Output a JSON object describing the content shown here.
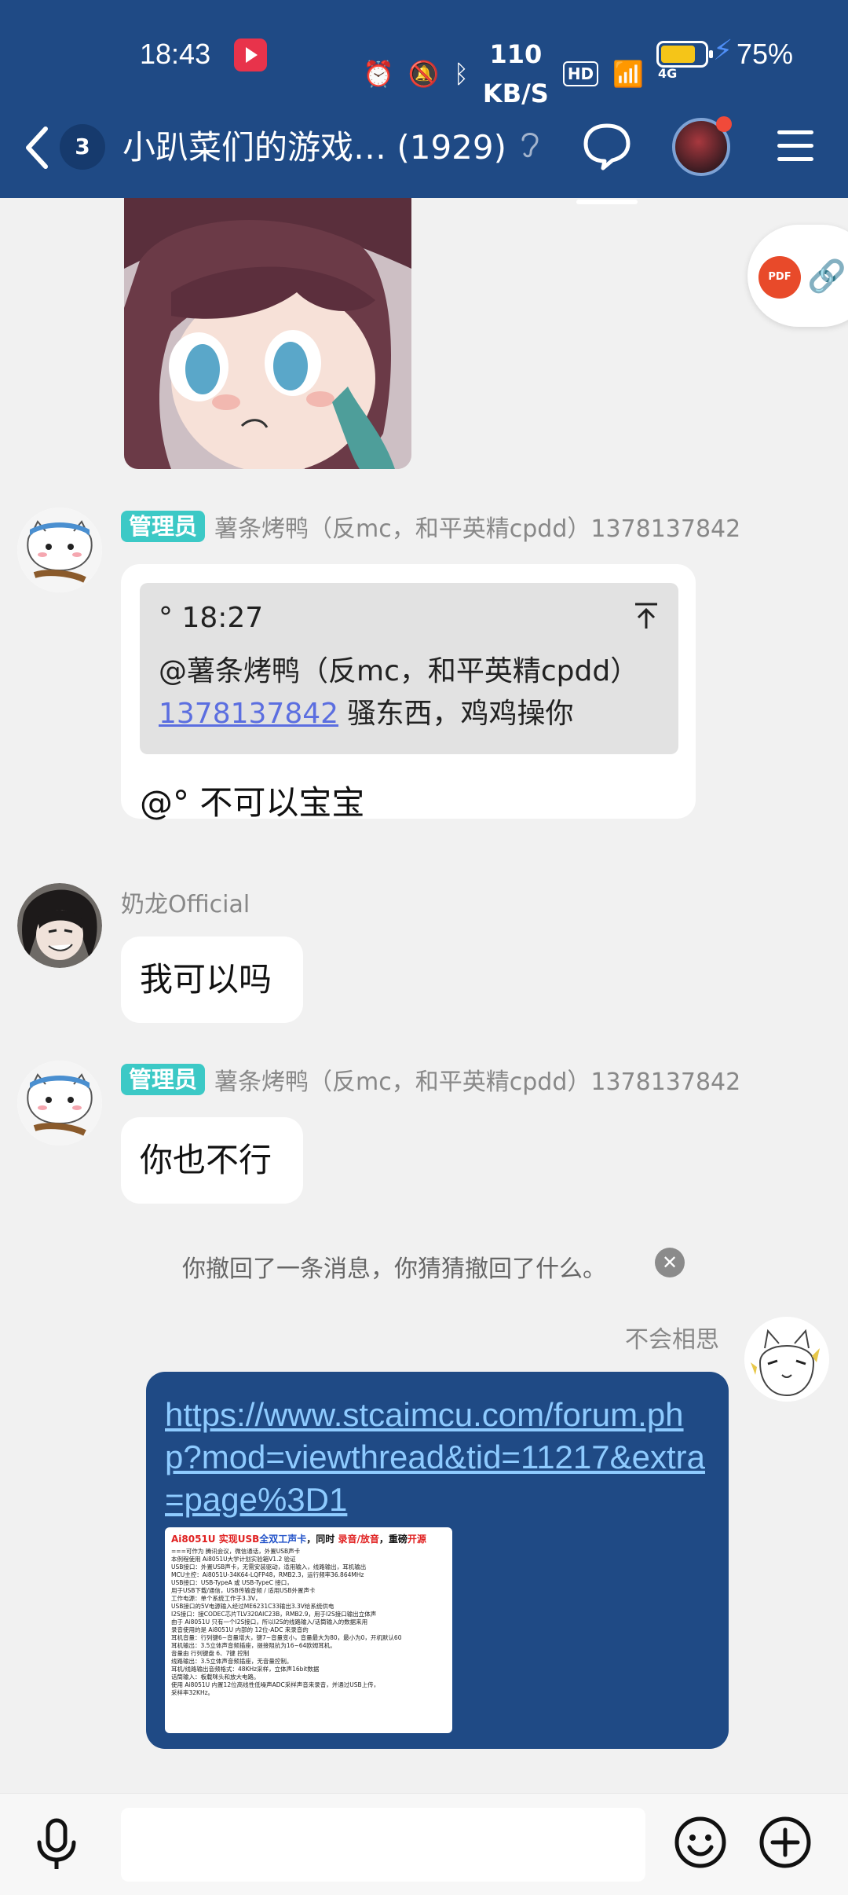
{
  "status_bar": {
    "time": "18:43",
    "network_speed_value": "110",
    "network_speed_unit": "KB/S",
    "hd_label": "HD",
    "signal_label": "4G",
    "battery_percent": "75%"
  },
  "header": {
    "unread_count": "3",
    "group_title": "小趴菜们的游戏…  (1929)"
  },
  "messages": [
    {
      "sender": "薯条烤鸭（反mc，和平英精cpdd）1378137842",
      "role_tag": "管理员",
      "quote": {
        "time": "° 18:27",
        "text_prefix": "@薯条烤鸭（反mc，和平英精cpdd）",
        "link": "1378137842",
        "text_suffix": " 骚东西，鸡鸡操你"
      },
      "text": "@° 不可以宝宝"
    },
    {
      "sender": "奶龙Official",
      "text": "我可以吗"
    },
    {
      "sender": "薯条烤鸭（反mc，和平英精cpdd）1378137842",
      "role_tag": "管理员",
      "text": "你也不行"
    }
  ],
  "system_message": "你撤回了一条消息，你猜猜撤回了什么。",
  "my_message": {
    "sender": "不会相思",
    "url": "https://www.stcaimcu.com/forum.php?mod=viewthread&tid=11217&extra=page%3D1",
    "preview": {
      "title_a": "Ai8051U 实现USB",
      "title_b": "全双工声卡",
      "title_c": "，同时 ",
      "title_d": "录音/放音",
      "title_e": "，重磅",
      "title_f": "开源",
      "lines": [
        "===可作为 腾讯会议，微信通话，外置USB声卡",
        "本例程使用 Ai8051U大学计划实验箱V1.2 验证",
        "USB接口：外置USB声卡，无需安装驱动，适用输入，线路输出，耳机输出",
        "MCU主控：Ai8051U-34K64-LQFP48，RMB2.3，运行频率36.864MHz",
        "USB接口：USB-TypeA 或 USB-TypeC 接口，",
        "          用于USB下载/通信，USB传输音频 / 适用USB外置声卡",
        "工作电源：单个系统工作于3.3V，",
        "          USB接口的5V电源输入经过ME6231C33输出3.3V给系统供电",
        "I2S接口：接CODEC芯片TLV320AIC23B，RMB2.9，用于I2S接口输出立体声",
        "          由于 Ai8051U 只有一个I2S接口，所以I2S的线路输入/话筒输入的数据来用",
        "          录音使用的是 Ai8051U 内部的 12位-ADC 来录音的",
        "耳机音量：行列键6~音量增大，键7~音量变小，音量最大为80，最小为0，开机默认60",
        "耳机输出：3.5立体声音频插座，提接阻抗为16~64欧姆耳机。",
        "          音量由 行列键盘 6、7键 控制",
        "线路输出：3.5立体声音频插座，无音量控制。",
        "          耳机/线路输出音频格式：48KHz采样，立体声16bit数据",
        "话筒输入：板载咪头和放大电路。",
        "          使用 Ai8051U 内置12位高线性低噪声ADC采样声音来录音，并通过USB上传，",
        "          采样率32KHz。"
      ]
    }
  },
  "float_panel": {
    "pdf_label": "PDF"
  },
  "colors": {
    "header_bg": "#1f4a85",
    "admin_tag": "#3cc9c6",
    "link_text": "#8ecbff",
    "quote_link": "#5b6ee0"
  },
  "icons": [
    "back-arrow-icon",
    "hearing-icon",
    "chat-bubble-icon",
    "menu-icon",
    "pdf-icon",
    "link-icon",
    "close-icon",
    "microphone-icon",
    "emoji-icon",
    "plus-icon"
  ]
}
